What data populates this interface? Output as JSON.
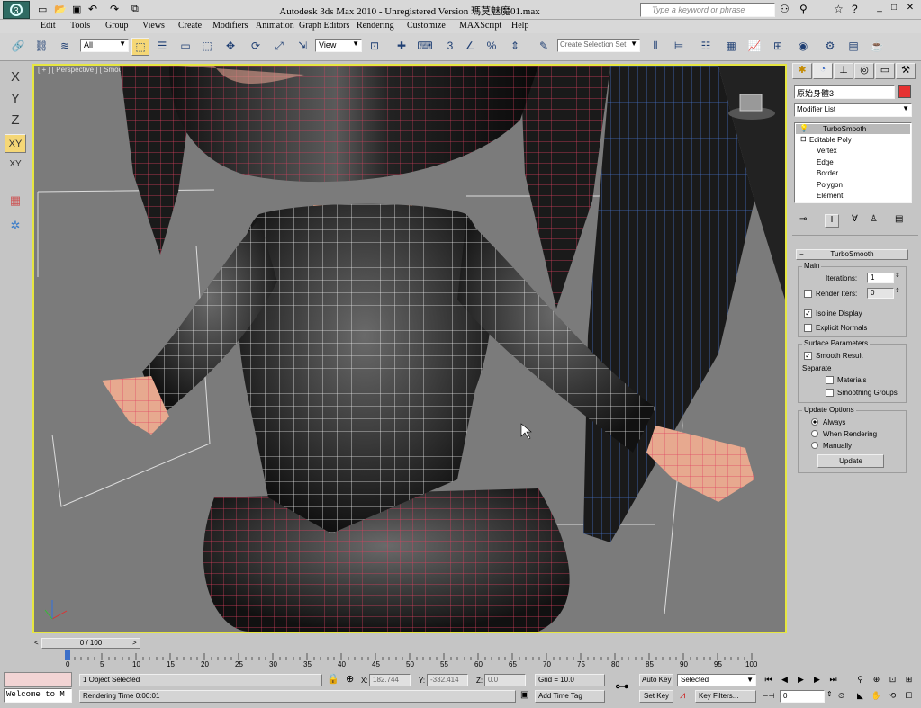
{
  "app": {
    "title": "Autodesk 3ds Max  2010  -  Unregistered Version    瑪莫魅魔01.max",
    "search_placeholder": "Type a keyword or phrase"
  },
  "menu": [
    "Edit",
    "Tools",
    "Group",
    "Views",
    "Create",
    "Modifiers",
    "Animation",
    "Graph Editors",
    "Rendering",
    "Customize",
    "MAXScript",
    "Help"
  ],
  "toolbar": {
    "filter_value": "All",
    "refcoord_value": "View",
    "selection_set_placeholder": "Create Selection Set",
    "snap_label": "3"
  },
  "axis_bar": [
    "X",
    "Y",
    "Z",
    "XY",
    "XY"
  ],
  "viewport": {
    "label": "[ + ] [ Perspective ] [ Smooth + Highlights + Edged Faces ]"
  },
  "command_panel": {
    "object_name": "原始身體3",
    "object_color": "#e63232",
    "modifier_list": "Modifier List",
    "stack": [
      "TurboSmooth",
      "Editable Poly",
      "Vertex",
      "Edge",
      "Border",
      "Polygon",
      "Element"
    ],
    "rollout_title": "TurboSmooth",
    "main_group": "Main",
    "iterations_label": "Iterations:",
    "iterations_value": "1",
    "render_iters_label": "Render Iters:",
    "render_iters_value": "0",
    "isoline_label": "Isoline Display",
    "explicit_normals_label": "Explicit Normals",
    "surface_group": "Surface Parameters",
    "smooth_result_label": "Smooth Result",
    "separate_label": "Separate",
    "materials_label": "Materials",
    "smoothing_groups_label": "Smoothing Groups",
    "update_group": "Update Options",
    "always_label": "Always",
    "when_rendering_label": "When Rendering",
    "manually_label": "Manually",
    "update_button": "Update"
  },
  "timeline": {
    "frame_counter": "0 / 100",
    "ticks": [
      "0",
      "5",
      "10",
      "15",
      "20",
      "25",
      "30",
      "35",
      "40",
      "45",
      "50",
      "55",
      "60",
      "65",
      "70",
      "75",
      "80",
      "85",
      "90",
      "95",
      "100"
    ]
  },
  "status": {
    "maxscript_listener": "Welcome to M",
    "selection_status": "1 Object Selected",
    "prompt": "Rendering Time  0:00:01",
    "x_label": "X:",
    "x_value": "182.744",
    "y_label": "Y:",
    "y_value": "-332.414",
    "z_label": "Z:",
    "z_value": "0.0",
    "grid": "Grid = 10.0",
    "add_time_tag": "Add Time Tag",
    "auto_key": "Auto Key",
    "set_key": "Set Key",
    "selected_value": "Selected",
    "key_filters": "Key Filters...",
    "current_frame": "0"
  }
}
